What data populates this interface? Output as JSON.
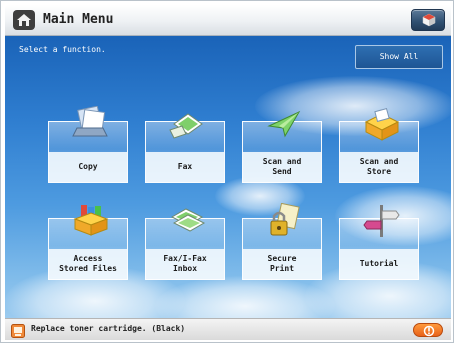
{
  "header": {
    "title": "Main Menu",
    "home_icon": "home-icon",
    "corner_icon": "cube-icon"
  },
  "main": {
    "prompt": "Select a function.",
    "show_all_label": "Show All",
    "functions": [
      {
        "label": "Copy",
        "icon": "copy-icon"
      },
      {
        "label": "Fax",
        "icon": "fax-icon"
      },
      {
        "label": "Scan and\nSend",
        "icon": "scan-send-icon"
      },
      {
        "label": "Scan and\nStore",
        "icon": "scan-store-icon"
      },
      {
        "label": "Access\nStored Files",
        "icon": "stored-files-icon"
      },
      {
        "label": "Fax/I-Fax\nInbox",
        "icon": "fax-inbox-icon"
      },
      {
        "label": "Secure\nPrint",
        "icon": "secure-print-icon"
      },
      {
        "label": "Tutorial",
        "icon": "tutorial-icon"
      }
    ]
  },
  "status": {
    "message": "Replace toner cartridge. (Black)",
    "warning_icon": "toner-warning-icon",
    "alert_icon": "alert-icon"
  },
  "colors": {
    "sky_top": "#1a63b8",
    "sky_bottom": "#9ccbef",
    "status_alert": "#e8621a"
  }
}
